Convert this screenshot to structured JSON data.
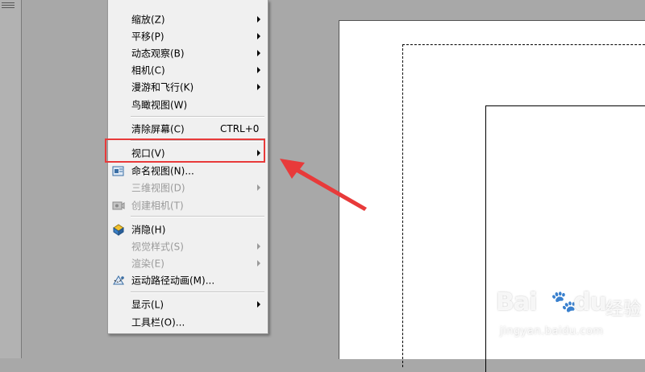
{
  "menu": {
    "items": [
      {
        "label": "缩放(Z)",
        "submenu": true
      },
      {
        "label": "平移(P)",
        "submenu": true
      },
      {
        "label": "动态观察(B)",
        "submenu": true
      },
      {
        "label": "相机(C)",
        "submenu": true
      },
      {
        "label": "漫游和飞行(K)",
        "submenu": true
      },
      {
        "label": "鸟瞰视图(W)"
      },
      {
        "label": "清除屏幕(C)",
        "shortcut": "CTRL+0"
      },
      {
        "label": "视口(V)",
        "submenu": true,
        "highlighted": true
      },
      {
        "label": "命名视图(N)...",
        "icon": "named-view-icon"
      },
      {
        "label": "三维视图(D)",
        "submenu": true,
        "disabled": true
      },
      {
        "label": "创建相机(T)",
        "icon": "camera-icon",
        "disabled": true
      },
      {
        "label": "消隐(H)",
        "icon": "hide-icon"
      },
      {
        "label": "视觉样式(S)",
        "submenu": true,
        "disabled": true
      },
      {
        "label": "渲染(E)",
        "submenu": true,
        "disabled": true
      },
      {
        "label": "运动路径动画(M)...",
        "icon": "motion-path-icon"
      },
      {
        "label": "显示(L)",
        "submenu": true
      },
      {
        "label": "工具栏(O)..."
      }
    ]
  },
  "annotation": {
    "color": "#e83a3a"
  },
  "watermark": {
    "brand": "Bai",
    "brand_tail": "du",
    "sub": "经验",
    "url": "jingyan.baidu.com"
  }
}
